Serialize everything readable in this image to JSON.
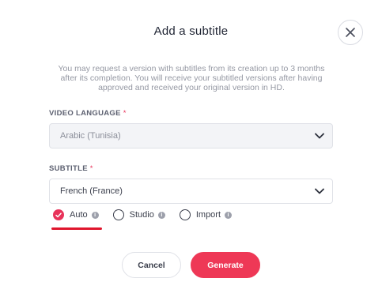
{
  "modal": {
    "title": "Add a subtitle",
    "description": "You may request a version with subtitles from its creation up to 3 months after its completion. You will receive your subtitled versions after having approved and received your original version in HD."
  },
  "video_language": {
    "label": "VIDEO LANGUAGE",
    "required_mark": "*",
    "value": "Arabic (Tunisia)"
  },
  "subtitle": {
    "label": "SUBTITLE",
    "required_mark": "*",
    "value": "French (France)"
  },
  "mode_options": [
    {
      "label": "Auto",
      "checked": true
    },
    {
      "label": "Studio",
      "checked": false
    },
    {
      "label": "Import",
      "checked": false
    }
  ],
  "info_glyph": "i",
  "actions": {
    "cancel_label": "Cancel",
    "generate_label": "Generate"
  },
  "colors": {
    "accent": "#ee3856",
    "annotation_underline": "#e0162d"
  },
  "icons": {
    "close": "close-icon",
    "chevron": "chevron-down-icon",
    "info": "info-icon",
    "check": "check-icon"
  }
}
